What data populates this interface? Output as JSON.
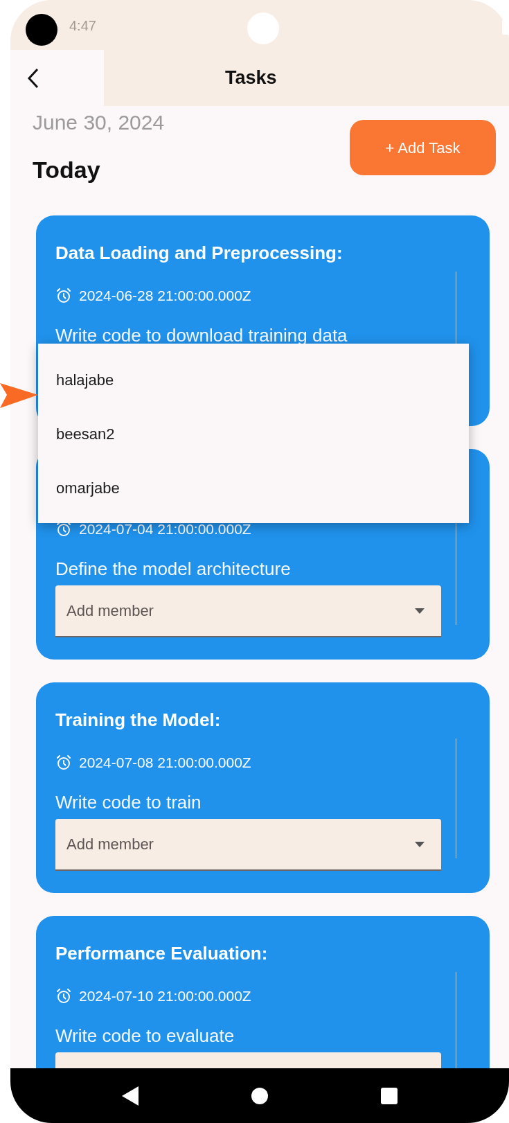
{
  "status_bar": {
    "time": "4:47"
  },
  "app_bar": {
    "title": "Tasks"
  },
  "date": "June 30, 2024",
  "heading": "Today",
  "add_button": {
    "label": "+ Add Task"
  },
  "tasks": [
    {
      "title": "Data Loading and Preprocessing:",
      "due": "2024-06-28 21:00:00.000Z",
      "description": "Write code to download training data"
    },
    {
      "due": "2024-07-04 21:00:00.000Z",
      "description": "Define the model architecture",
      "member_placeholder": "Add member"
    },
    {
      "title": "Training the Model:",
      "due": "2024-07-08 21:00:00.000Z",
      "description": "Write code to train",
      "member_placeholder": "Add member"
    },
    {
      "title": "Performance Evaluation:",
      "due": "2024-07-10 21:00:00.000Z",
      "description": "Write code to evaluate"
    }
  ],
  "member_menu": {
    "options": [
      "halajabe",
      "beesan2",
      "omarjabe"
    ]
  }
}
